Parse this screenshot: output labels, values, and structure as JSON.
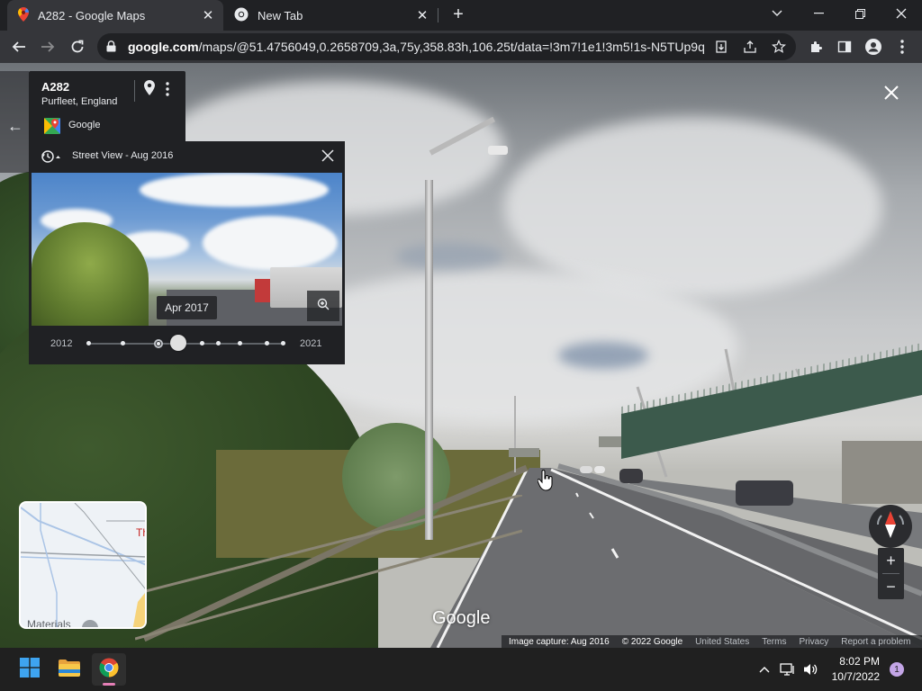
{
  "browser": {
    "tabs": [
      {
        "title": "A282 - Google Maps",
        "icon": "google-maps-pin-icon",
        "active": true
      },
      {
        "title": "New Tab",
        "icon": "chrome-icon",
        "active": false
      }
    ],
    "url_host": "google.com",
    "url_path": "/maps/@51.4756049,0.2658709,3a,75y,358.83h,106.25t/data=!3m7!1e1!3m5!1s-N5TUp9q..."
  },
  "place_card": {
    "title": "A282",
    "subtitle": "Purfleet, England",
    "brand": "Google"
  },
  "time_machine": {
    "header": "Street View - Aug 2016",
    "tooltip": "Apr 2017",
    "year_start": "2012",
    "year_end": "2021",
    "slider_position": "Apr 2017"
  },
  "map": {
    "watermark": "Google",
    "minimap_label": "Materials",
    "minimap_partial_label": "Th"
  },
  "footer": {
    "image_capture": "Image capture: Aug 2016",
    "copyright": "© 2022 Google",
    "country": "United States",
    "terms": "Terms",
    "privacy": "Privacy",
    "report": "Report a problem"
  },
  "taskbar": {
    "time": "8:02 PM",
    "date": "10/7/2022",
    "notification_count": "1"
  },
  "colors": {
    "chrome_dark": "#202124",
    "chrome_toolbar": "#35363a",
    "compass_red": "#ea4335"
  }
}
